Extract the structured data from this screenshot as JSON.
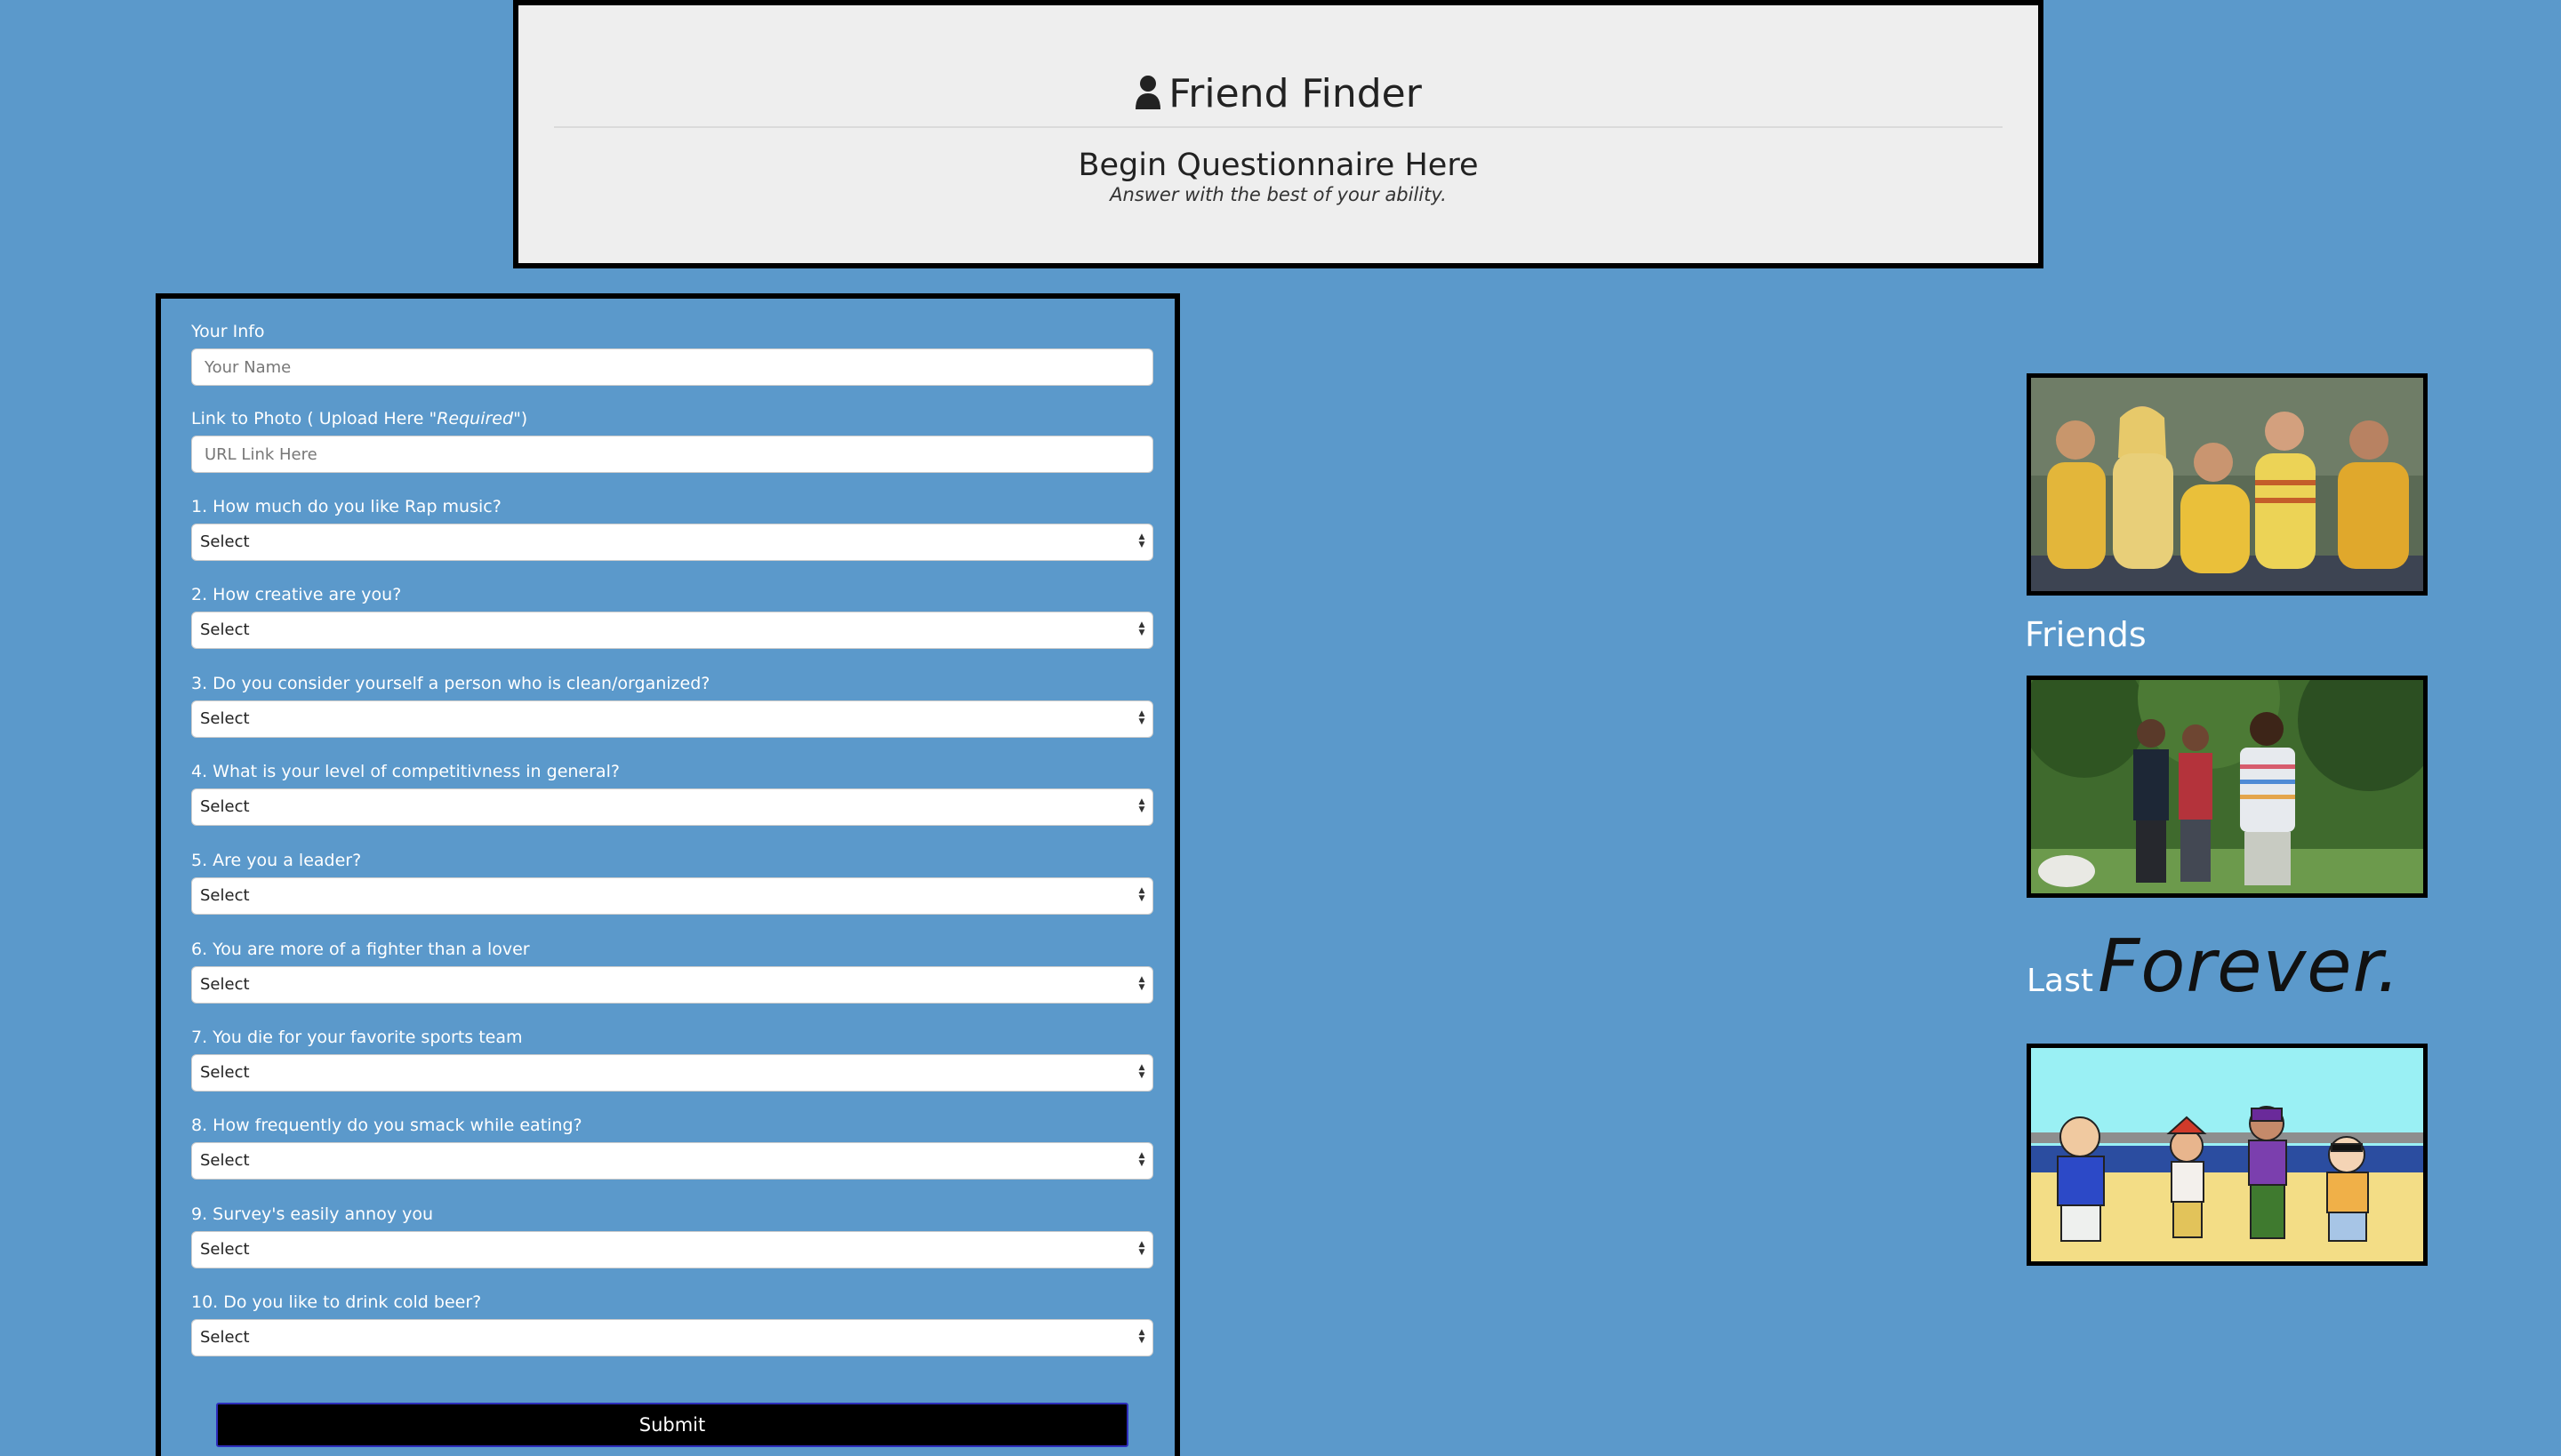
{
  "header": {
    "title": "Friend Finder",
    "subtitle": "Begin Questionnaire Here",
    "note": "Answer with the best of your ability."
  },
  "form": {
    "name_label": "Your Info",
    "name_placeholder": "Your Name",
    "photo_label_prefix": "Link to Photo ( Upload Here \"",
    "photo_label_required": "Required",
    "photo_label_suffix": "\")",
    "photo_placeholder": "URL Link Here",
    "questions": [
      {
        "label": "1. How much do you like Rap music?",
        "value": "Select"
      },
      {
        "label": "2. How creative are you?",
        "value": "Select"
      },
      {
        "label": "3. Do you consider yourself a person who is clean/organized?",
        "value": "Select"
      },
      {
        "label": "4. What is your level of competitivness in general?",
        "value": "Select"
      },
      {
        "label": "5. Are you a leader?",
        "value": "Select"
      },
      {
        "label": "6. You are more of a fighter than a lover",
        "value": "Select"
      },
      {
        "label": "7. You die for your favorite sports team",
        "value": "Select"
      },
      {
        "label": "8. How frequently do you smack while eating?",
        "value": "Select"
      },
      {
        "label": "9. Survey's easily annoy you",
        "value": "Select"
      },
      {
        "label": "10. Do you like to drink cold beer?",
        "value": "Select"
      }
    ],
    "submit_label": "Submit"
  },
  "sidebar": {
    "friends_text": "Friends",
    "last_text": "Last",
    "forever_text": "Forever."
  },
  "colors": {
    "background": "#5b99cb",
    "jumbotron": "#eeeeee",
    "submit": "#000000"
  }
}
